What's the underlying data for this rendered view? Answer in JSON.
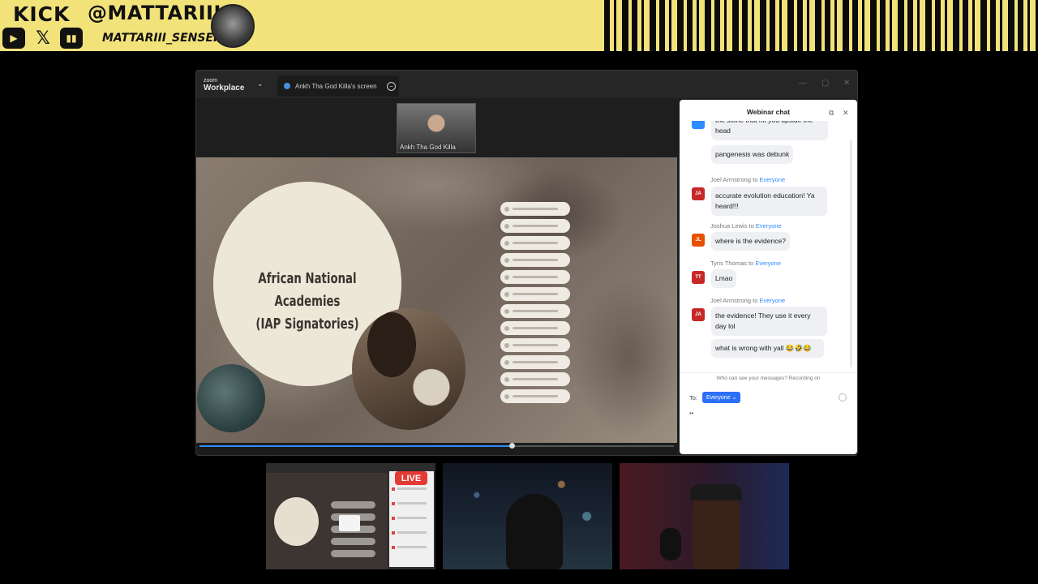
{
  "banner": {
    "platform": "KICK",
    "handle": "@MATTARIII",
    "secondary_handle": "MATTARIII_SENSEI",
    "socials": [
      "youtube-icon",
      "x-icon",
      "twitch-icon"
    ]
  },
  "zoom": {
    "brand_top": "zoom",
    "brand_bottom": "Workplace",
    "tab_label": "Ankh Tha God Killa's screen",
    "presenter_name": "Ankh Tha God Killa",
    "slide_title_line1": "African National Academies",
    "slide_title_line2": "(IAP Signatories)",
    "progress_fraction": 0.66
  },
  "chat": {
    "title": "Webinar chat",
    "to_word": "to",
    "messages": [
      {
        "sender": "",
        "to": "",
        "text": "the stone that hit you upside the head",
        "initials": "",
        "color": "#2d8cff"
      },
      {
        "sender": "",
        "to": "",
        "text": "pangenesis was debunk",
        "initials": "",
        "color": ""
      },
      {
        "sender": "Joel Armstrong",
        "to": "Everyone",
        "text": "accurate evolution education! Ya heard!!!",
        "initials": "JA",
        "color": "#c62828"
      },
      {
        "sender": "Joshua Lewis",
        "to": "Everyone",
        "text": "where is the evidence?",
        "initials": "JL",
        "color": "#e65100"
      },
      {
        "sender": "Tyris Thomas",
        "to": "Everyone",
        "text": "Lmao",
        "initials": "TT",
        "color": "#c62828"
      },
      {
        "sender": "Joel Armstrong",
        "to": "Everyone",
        "text": "the evidence! They use it every day lol",
        "initials": "JA",
        "color": "#c62828"
      },
      {
        "sender": "",
        "to": "",
        "text": "what is wrong with yall 😂🤣😂",
        "initials": "",
        "color": ""
      }
    ],
    "privacy_note": "Who can see your messages? Recording on",
    "to_label": "To:",
    "recipient": "Everyone ⌄",
    "typing": "••"
  },
  "feeds": {
    "live_badge": "LIVE"
  }
}
